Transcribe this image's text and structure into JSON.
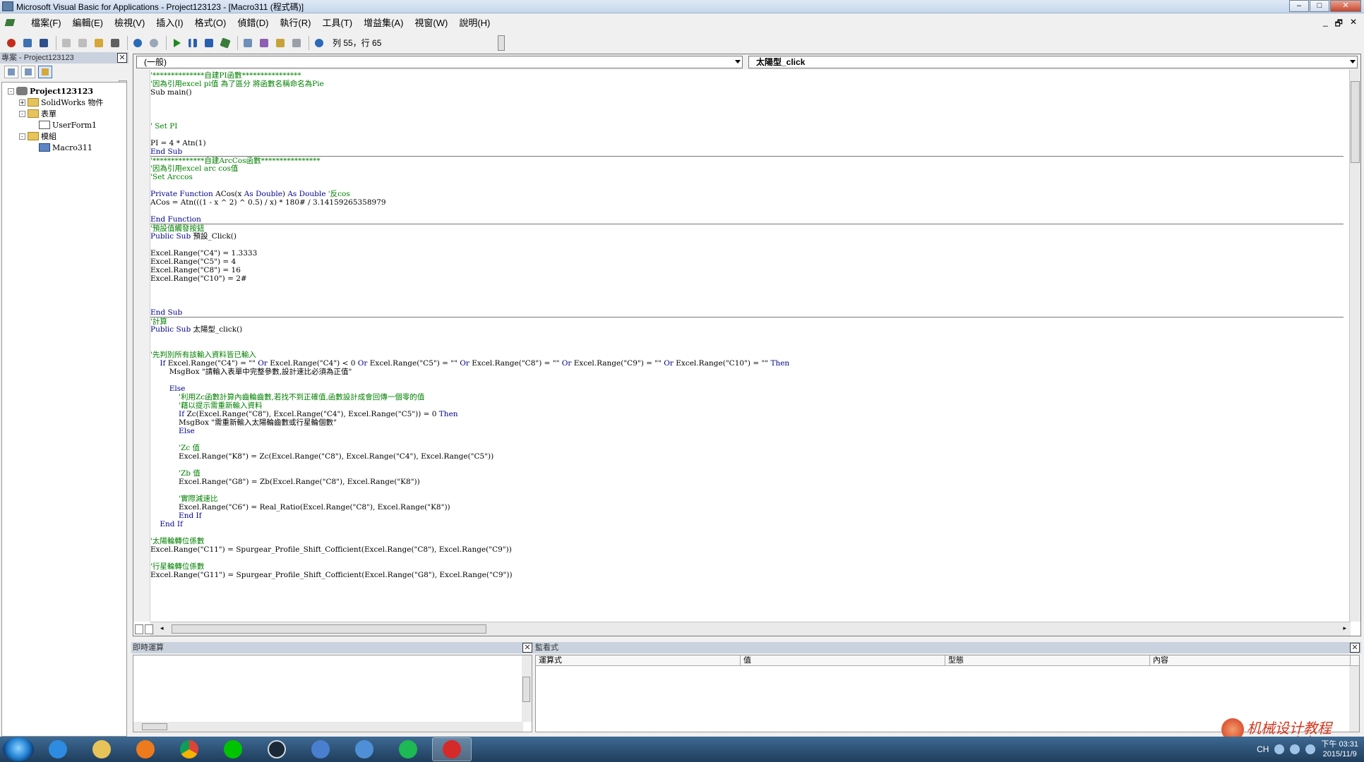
{
  "window": {
    "title": "Microsoft Visual Basic for Applications - Project123123 - [Macro311 (程式碼)]"
  },
  "menu": {
    "items": [
      "檔案(F)",
      "編輯(E)",
      "檢視(V)",
      "插入(I)",
      "格式(O)",
      "偵錯(D)",
      "執行(R)",
      "工具(T)",
      "增益集(A)",
      "視窗(W)",
      "說明(H)"
    ]
  },
  "toolbar": {
    "position": "列 55，行 65",
    "icons": [
      "excel-icon",
      "insert-userform-icon",
      "save-icon",
      "cut-icon",
      "copy-icon",
      "paste-icon",
      "find-icon",
      "undo-icon",
      "redo-icon",
      "run-icon",
      "pause-icon",
      "stop-icon",
      "design-mode-icon",
      "project-explorer-icon",
      "properties-icon",
      "object-browser-icon",
      "toolbox-icon",
      "help-icon"
    ]
  },
  "project": {
    "header": "專案 - Project123123",
    "tree": [
      {
        "label": "Project123123",
        "level": 0,
        "icon": "project",
        "expander": "-",
        "bold": true
      },
      {
        "label": "SolidWorks 物件",
        "level": 1,
        "icon": "folder",
        "expander": "+"
      },
      {
        "label": "表單",
        "level": 1,
        "icon": "folder",
        "expander": "-"
      },
      {
        "label": "UserForm1",
        "level": 2,
        "icon": "form",
        "expander": ""
      },
      {
        "label": "模組",
        "level": 1,
        "icon": "folder",
        "expander": "-"
      },
      {
        "label": "Macro311",
        "level": 2,
        "icon": "module",
        "expander": ""
      }
    ]
  },
  "code_window": {
    "object_combo": "(一般)",
    "procedure_combo": "太陽型_click"
  },
  "code": [
    {
      "text": "'**************自建PI函數****************",
      "type": "comment"
    },
    {
      "text": "'因為引用excel pi值 為了區分 將函數名稱命名為Pie",
      "type": "comment"
    },
    {
      "text": "Sub main()",
      "type": "code"
    },
    {
      "text": "",
      "type": "code"
    },
    {
      "text": "",
      "type": "code"
    },
    {
      "text": "",
      "type": "code"
    },
    {
      "text": "' Set PI",
      "type": "comment"
    },
    {
      "text": "",
      "type": "code"
    },
    {
      "text": "PI = 4 * Atn(1)",
      "type": "code"
    },
    {
      "text": "End Sub",
      "type": "kw"
    },
    {
      "text": "'**************自建ArcCos函數****************",
      "type": "comment",
      "sep": true
    },
    {
      "text": "'因為引用excel arc cos值",
      "type": "comment"
    },
    {
      "text": "'Set Arccos",
      "type": "comment"
    },
    {
      "text": "",
      "type": "code"
    },
    {
      "text": "Private Function ACos(x As Double) As Double '反cos",
      "type": "mixed",
      "parts": [
        [
          "Private Function ",
          "kw"
        ],
        [
          "ACos(x ",
          ""
        ],
        [
          "As Double",
          "kw"
        ],
        [
          ") ",
          ""
        ],
        [
          "As Double",
          "kw"
        ],
        [
          " '反cos",
          "c"
        ]
      ]
    },
    {
      "text": "ACos = Atn(((1 - x ^ 2) ^ 0.5) / x) * 180# / 3.14159265358979",
      "type": "code"
    },
    {
      "text": "",
      "type": "code"
    },
    {
      "text": "End Function",
      "type": "kw"
    },
    {
      "text": "'預設值觸發按鈕",
      "type": "comment",
      "sep": true
    },
    {
      "text": "Public Sub 預設_Click()",
      "type": "mixed",
      "parts": [
        [
          "Public Sub ",
          "kw"
        ],
        [
          "預設_Click()",
          ""
        ]
      ]
    },
    {
      "text": "",
      "type": "code"
    },
    {
      "text": "Excel.Range(\"C4\") = 1.3333",
      "type": "code"
    },
    {
      "text": "Excel.Range(\"C5\") = 4",
      "type": "code"
    },
    {
      "text": "Excel.Range(\"C8\") = 16",
      "type": "code"
    },
    {
      "text": "Excel.Range(\"C10\") = 2#",
      "type": "code"
    },
    {
      "text": "",
      "type": "code"
    },
    {
      "text": "",
      "type": "code"
    },
    {
      "text": "",
      "type": "code"
    },
    {
      "text": "End Sub",
      "type": "kw"
    },
    {
      "text": "'計算",
      "type": "comment",
      "sep": true
    },
    {
      "text": "Public Sub 太陽型_click()",
      "type": "mixed",
      "parts": [
        [
          "Public Sub ",
          "kw"
        ],
        [
          "太陽型_click()",
          ""
        ]
      ]
    },
    {
      "text": "",
      "type": "code"
    },
    {
      "text": "",
      "type": "code"
    },
    {
      "text": "'先判別所有該輸入資料皆已輸入",
      "type": "comment"
    },
    {
      "text": "    If Excel.Range(\"C4\") = \"\" Or Excel.Range(\"C4\") < 0 Or Excel.Range(\"C5\") = \"\" Or Excel.Range(\"C8\") = \"\" Or Excel.Range(\"C9\") = \"\" Or Excel.Range(\"C10\") = \"\" Then",
      "type": "mixed",
      "parts": [
        [
          "    If ",
          "kw"
        ],
        [
          "Excel.Range(\"C4\") = \"\" ",
          ""
        ],
        [
          "Or ",
          "kw"
        ],
        [
          "Excel.Range(\"C4\") < 0 ",
          ""
        ],
        [
          "Or ",
          "kw"
        ],
        [
          "Excel.Range(\"C5\") = \"\" ",
          ""
        ],
        [
          "Or ",
          "kw"
        ],
        [
          "Excel.Range(\"C8\") = \"\" ",
          ""
        ],
        [
          "Or ",
          "kw"
        ],
        [
          "Excel.Range(\"C9\") = \"\" ",
          ""
        ],
        [
          "Or ",
          "kw"
        ],
        [
          "Excel.Range(\"C10\") = \"\" ",
          ""
        ],
        [
          "Then",
          "kw"
        ]
      ]
    },
    {
      "text": "        MsgBox \"請輸入表單中完整參數,設計速比必須為正值\"",
      "type": "code"
    },
    {
      "text": "",
      "type": "code"
    },
    {
      "text": "        Else",
      "type": "kw"
    },
    {
      "text": "            '利用Zc函數計算內齒輪齒數,若找不到正確值,函數設計成會回傳一個零的值",
      "type": "comment"
    },
    {
      "text": "            '藉以提示需重新輸入資料",
      "type": "comment"
    },
    {
      "text": "            If Zc(Excel.Range(\"C8\"), Excel.Range(\"C4\"), Excel.Range(\"C5\")) = 0 Then",
      "type": "mixed",
      "parts": [
        [
          "            If ",
          "kw"
        ],
        [
          "Zc(Excel.Range(\"C8\"), Excel.Range(\"C4\"), Excel.Range(\"C5\")) = 0 ",
          ""
        ],
        [
          "Then",
          "kw"
        ]
      ]
    },
    {
      "text": "            MsgBox \"需重新輸入太陽輪齒數或行星輪個數\"",
      "type": "code"
    },
    {
      "text": "            Else",
      "type": "kw"
    },
    {
      "text": "",
      "type": "code"
    },
    {
      "text": "            'Zc 值",
      "type": "comment"
    },
    {
      "text": "            Excel.Range(\"K8\") = Zc(Excel.Range(\"C8\"), Excel.Range(\"C4\"), Excel.Range(\"C5\"))",
      "type": "code"
    },
    {
      "text": "",
      "type": "code"
    },
    {
      "text": "            'Zb 值",
      "type": "comment"
    },
    {
      "text": "            Excel.Range(\"G8\") = Zb(Excel.Range(\"C8\"), Excel.Range(\"K8\"))",
      "type": "code"
    },
    {
      "text": "",
      "type": "code"
    },
    {
      "text": "            '實際減速比",
      "type": "comment"
    },
    {
      "text": "            Excel.Range(\"C6\") = Real_Ratio(Excel.Range(\"C8\"), Excel.Range(\"K8\"))",
      "type": "code"
    },
    {
      "text": "            End If",
      "type": "kw"
    },
    {
      "text": "    End If",
      "type": "kw"
    },
    {
      "text": "",
      "type": "code"
    },
    {
      "text": "'太陽輪轉位係數",
      "type": "comment"
    },
    {
      "text": "Excel.Range(\"C11\") = Spurgear_Profile_Shift_Cofficient(Excel.Range(\"C8\"), Excel.Range(\"C9\"))",
      "type": "code"
    },
    {
      "text": "",
      "type": "code"
    },
    {
      "text": "'行星輪轉位係數",
      "type": "comment"
    },
    {
      "text": "Excel.Range(\"G11\") = Spurgear_Profile_Shift_Cofficient(Excel.Range(\"G8\"), Excel.Range(\"C9\"))",
      "type": "code"
    }
  ],
  "immediate": {
    "header": "即時運算"
  },
  "watch": {
    "header": "監看式",
    "columns": [
      "運算式",
      "值",
      "型態",
      "內容"
    ]
  },
  "taskbar": {
    "apps": [
      "ie-icon",
      "file-explorer-icon",
      "media-player-icon",
      "chrome-icon",
      "line-icon",
      "steam-icon",
      "video-player-icon",
      "k-app-icon",
      "spotify-icon",
      "solidworks-icon"
    ],
    "active_index": 9,
    "lang": "CH",
    "time": "下午 03:31",
    "date": "2015/11/9"
  },
  "watermark": {
    "text": "机械设计教程",
    "url": "www.xgjxsj.com"
  }
}
